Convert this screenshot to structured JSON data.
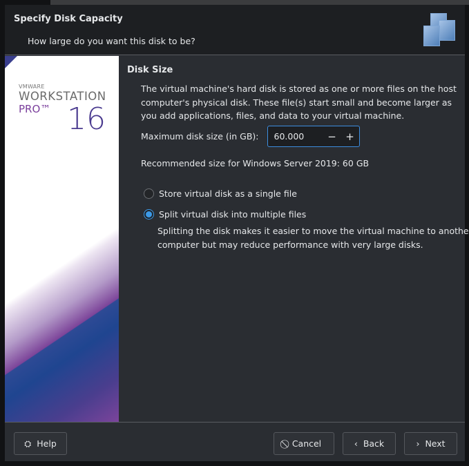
{
  "header": {
    "title": "Specify Disk Capacity",
    "subtitle": "How large do you want this disk to be?"
  },
  "branding": {
    "vendor": "VMWARE",
    "product": "WORKSTATION",
    "edition": "PRO™",
    "version": "16"
  },
  "section": {
    "title": "Disk Size",
    "description": "The virtual machine's hard disk is stored as one or more files on the host computer's physical disk. These file(s) start small and become larger as you add applications, files, and data to your virtual machine."
  },
  "disk_size": {
    "label": "Maximum disk size (in GB):",
    "value": "60.000",
    "decrement": "−",
    "increment": "+"
  },
  "recommended": "Recommended size for Windows Server 2019: 60 GB",
  "options": [
    {
      "label": "Store virtual disk as a single file",
      "selected": false
    },
    {
      "label": "Split virtual disk into multiple files",
      "selected": true
    }
  ],
  "split_note": "Splitting the disk makes it easier to move the virtual machine to another computer but may reduce performance with very large disks.",
  "buttons": {
    "help": "Help",
    "cancel": "Cancel",
    "back": "Back",
    "next": "Next"
  },
  "colors": {
    "accent": "#3d9ae8"
  }
}
